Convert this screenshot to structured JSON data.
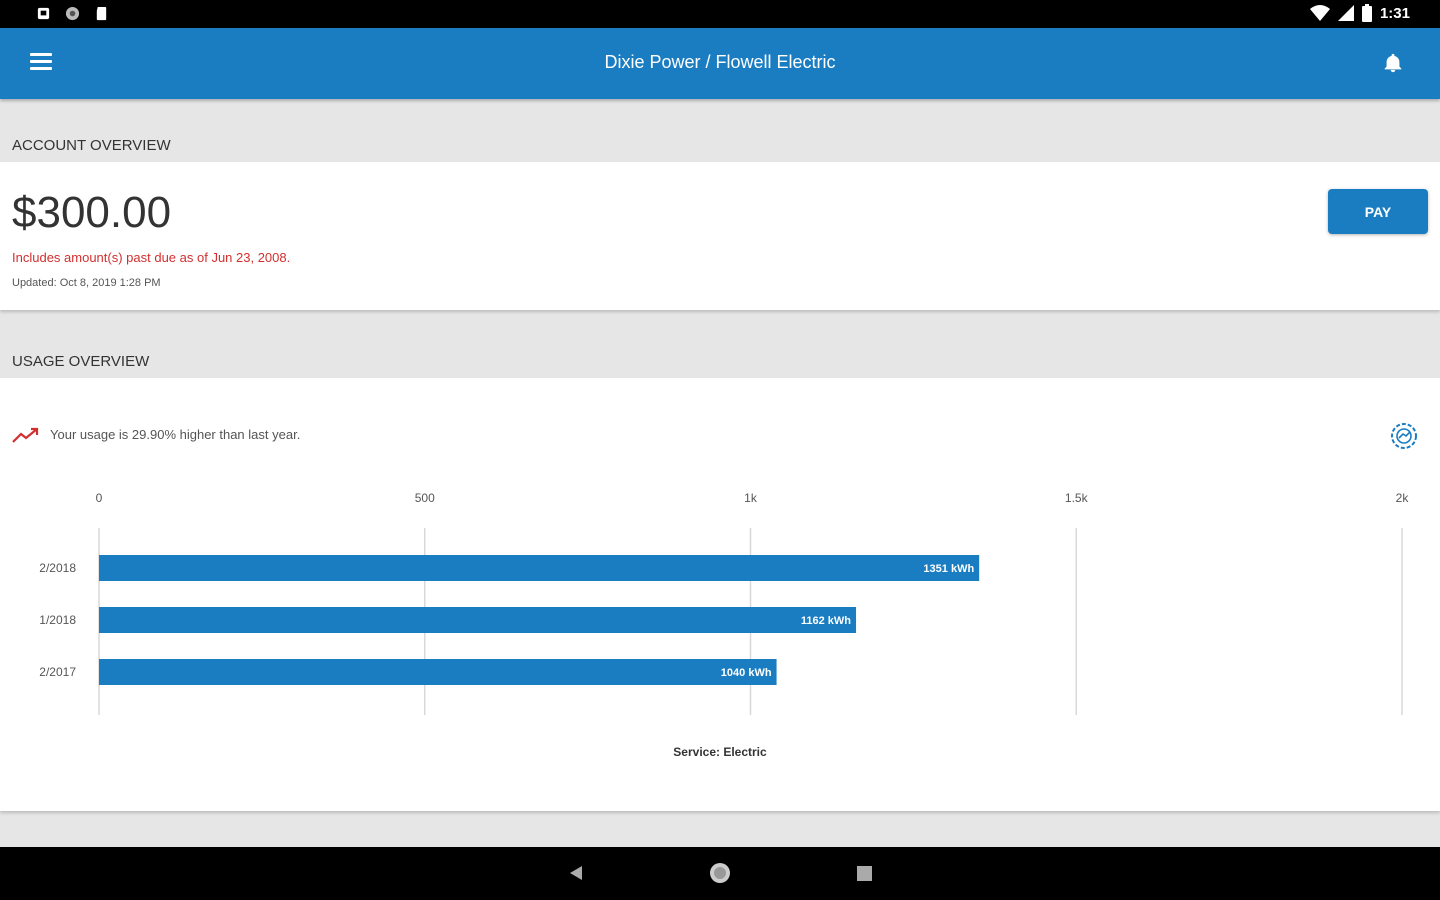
{
  "status_bar": {
    "time": "1:31",
    "left_icons": [
      "notification-icon",
      "circle-status-icon",
      "sd-card-icon"
    ],
    "right_icons": [
      "wifi-icon",
      "signal-icon",
      "battery-icon"
    ]
  },
  "app_bar": {
    "title": "Dixie Power / Flowell Electric",
    "menu_icon": "menu-icon",
    "bell_icon": "bell-icon",
    "color": "#1a7dc2"
  },
  "account": {
    "section_title": "ACCOUNT OVERVIEW",
    "amount": "$300.00",
    "past_due_text": "Includes amount(s) past due as of Jun 23, 2008.",
    "updated_text": "Updated:  Oct 8, 2019 1:28 PM",
    "pay_label": "PAY"
  },
  "usage": {
    "section_title": "USAGE OVERVIEW",
    "summary_text": "Your usage is 29.90% higher than last year.",
    "trend_icon": "trend-up-icon",
    "settings_icon": "chart-settings-icon"
  },
  "chart_data": {
    "type": "bar",
    "orientation": "horizontal",
    "categories": [
      "2/2018",
      "1/2018",
      "2/2017"
    ],
    "values": [
      1351,
      1162,
      1040
    ],
    "value_labels": [
      "1351 kWh",
      "1162 kWh",
      "1040 kWh"
    ],
    "unit": "kWh",
    "xlim": [
      0,
      2000
    ],
    "ticks": [
      0,
      500,
      1000,
      1500,
      2000
    ],
    "tick_labels": [
      "0",
      "500",
      "1k",
      "1.5k",
      "2k"
    ],
    "xlabel": "Service: Electric",
    "grid": true,
    "bar_color": "#1a7dc2"
  },
  "nav_bar": {
    "buttons": [
      "back-icon",
      "home-icon",
      "recents-icon"
    ]
  }
}
